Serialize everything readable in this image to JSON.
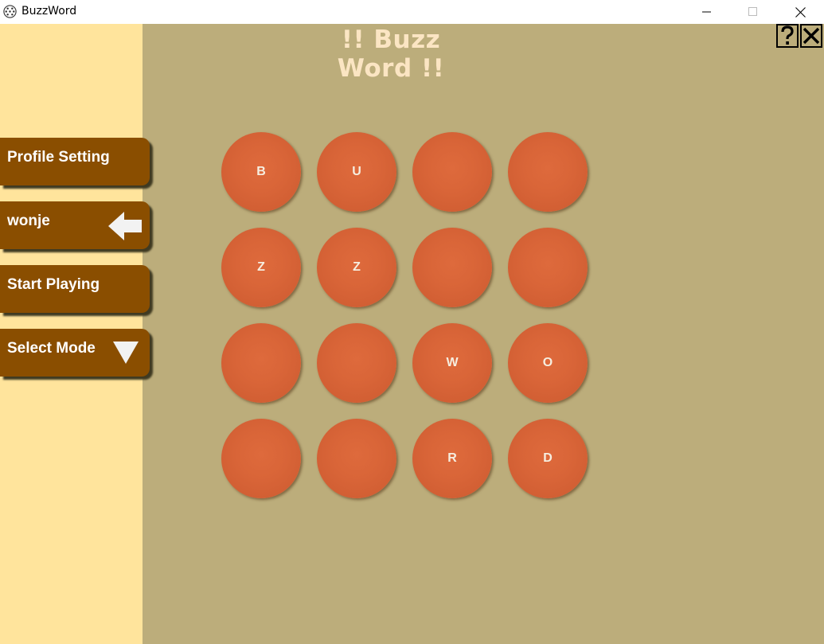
{
  "window": {
    "title": "BuzzWord"
  },
  "header": {
    "title": "!! Buzz Word !!"
  },
  "sidebar": {
    "buttons": [
      {
        "label": "Profile Setting"
      },
      {
        "label": "wonje",
        "icon": "arrow-left-icon"
      },
      {
        "label": "Start Playing"
      },
      {
        "label": "Select Mode",
        "icon": "triangle-down-icon"
      }
    ]
  },
  "toolbar": {
    "help_icon": "help-icon",
    "close_icon": "close-icon"
  },
  "board": {
    "rows": [
      [
        "B",
        "U",
        "",
        ""
      ],
      [
        "Z",
        "Z",
        "",
        ""
      ],
      [
        "",
        "",
        "W",
        "O"
      ],
      [
        "",
        "",
        "R",
        "D"
      ]
    ]
  },
  "colors": {
    "sidebar_bg": "#ffe49c",
    "main_bg": "#bcad7b",
    "button_bg": "#8a4e00",
    "tile": "#d96538",
    "title": "#fbe5c3"
  }
}
